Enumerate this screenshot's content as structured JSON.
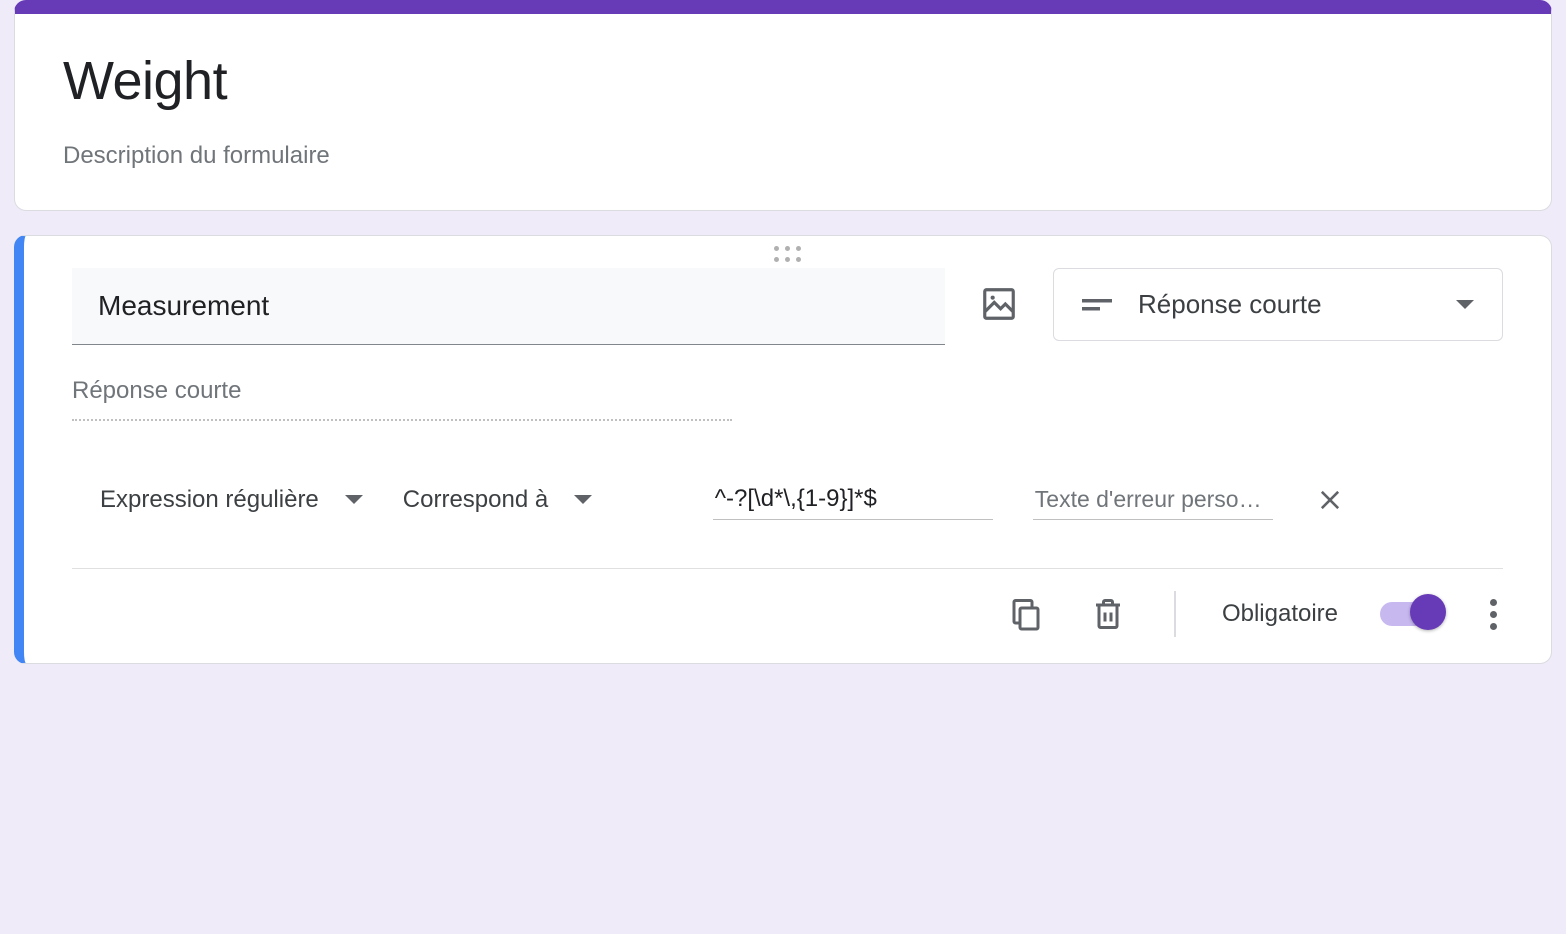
{
  "form": {
    "title": "Weight",
    "description": "Description du formulaire"
  },
  "question": {
    "title": "Measurement",
    "typeLabel": "Réponse courte",
    "answerPlaceholder": "Réponse courte"
  },
  "validation": {
    "typeLabel": "Expression régulière",
    "matchLabel": "Correspond à",
    "pattern": "^-?[\\d*\\,{1-9}]*$",
    "errorPlaceholder": "Texte d'erreur perso…"
  },
  "footer": {
    "requiredLabel": "Obligatoire",
    "requiredOn": true
  }
}
